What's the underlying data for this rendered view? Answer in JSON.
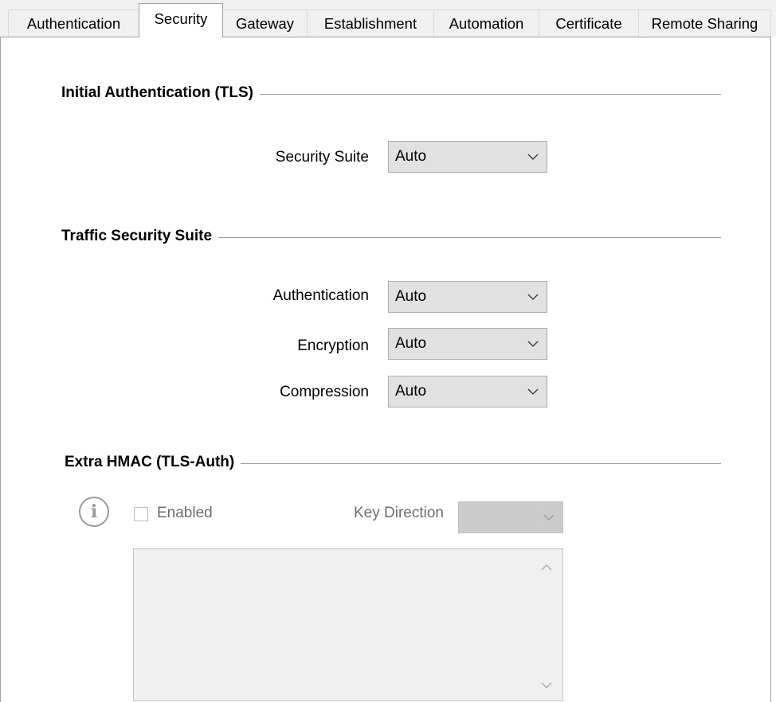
{
  "tabs": [
    {
      "label": "Authentication",
      "active": false
    },
    {
      "label": "Security",
      "active": true
    },
    {
      "label": "Gateway",
      "active": false
    },
    {
      "label": "Establishment",
      "active": false
    },
    {
      "label": "Automation",
      "active": false
    },
    {
      "label": "Certificate",
      "active": false
    },
    {
      "label": "Remote Sharing",
      "active": false
    }
  ],
  "initial_auth": {
    "title": "Initial Authentication (TLS)",
    "security_suite": {
      "label": "Security Suite",
      "value": "Auto"
    }
  },
  "traffic": {
    "title": "Traffic Security Suite",
    "authentication": {
      "label": "Authentication",
      "value": "Auto"
    },
    "encryption": {
      "label": "Encryption",
      "value": "Auto"
    },
    "compression": {
      "label": "Compression",
      "value": "Auto"
    }
  },
  "hmac": {
    "title": "Extra HMAC (TLS-Auth)",
    "info_glyph": "i",
    "enabled_label": "Enabled",
    "enabled_checked": false,
    "key_direction_label": "Key Direction",
    "key_direction_value": "",
    "key_text": ""
  },
  "icons": {
    "chevron": "chevron-down-icon",
    "info": "info-icon",
    "scroll_up": "chevron-up-icon",
    "scroll_down": "chevron-down-icon"
  },
  "colors": {
    "panel_border": "#a0a0a0",
    "combo_bg": "#e1e1e1",
    "disabled_text": "#6d6d6d"
  }
}
